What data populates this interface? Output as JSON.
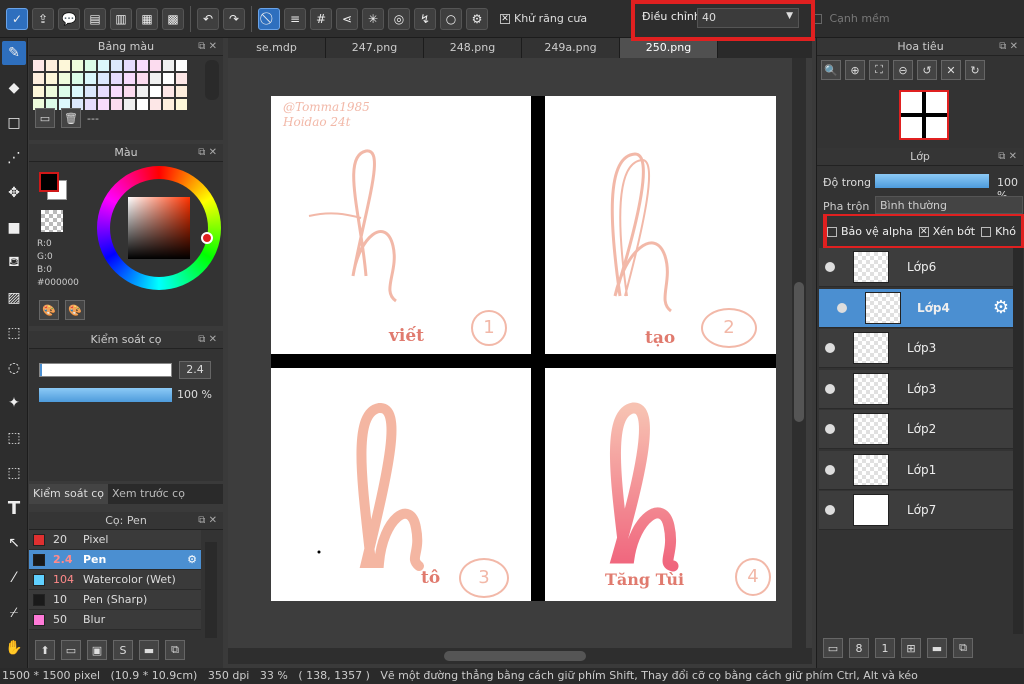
{
  "toolbar": {
    "antialias_label": "Khử răng cưa",
    "adjust_label": "Điều chỉnh",
    "adjust_value": "40",
    "smooth_edge_label": "Cạnh mềm"
  },
  "palette_panel": {
    "title": "Bảng màu",
    "value_text": "---"
  },
  "color_panel": {
    "title": "Màu",
    "r": "R:0",
    "g": "G:0",
    "b": "B:0",
    "hex": "#000000"
  },
  "brush_control": {
    "title": "Kiểm soát cọ",
    "size": "2.4",
    "opacity": "100 %"
  },
  "left_tabs": {
    "tab1": "Kiểm soát cọ",
    "tab2": "Xem trước cọ"
  },
  "brush_panel": {
    "title": "Cọ: Pen",
    "items": [
      {
        "size": "20",
        "name": "Pixel",
        "color": "#e03030"
      },
      {
        "size": "2.4",
        "name": "Pen",
        "color": "#1a1a1a"
      },
      {
        "size": "104",
        "name": "Watercolor (Wet)",
        "color": "#5fd0ff"
      },
      {
        "size": "10",
        "name": "Pen (Sharp)",
        "color": "#1a1a1a"
      },
      {
        "size": "50",
        "name": "Blur",
        "color": "#ff7ad8"
      }
    ]
  },
  "tabs": [
    "se.mdp",
    "247.png",
    "248.png",
    "249a.png",
    "250.png"
  ],
  "canvas": {
    "signature": "@Tomma1985 Hoidao 24t",
    "q1": {
      "word": "viết",
      "num": "1"
    },
    "q2": {
      "word": "tạo",
      "num": "2"
    },
    "q3": {
      "word": "tô",
      "num": "3"
    },
    "q4": {
      "word": "Tăng Tùi",
      "num": "4"
    }
  },
  "navigator": {
    "title": "Hoa tiêu"
  },
  "layer_panel": {
    "title": "Lớp",
    "opacity_label": "Độ trong",
    "opacity_value": "100 %",
    "opacity_level": 1.0,
    "blend_label": "Pha trộn",
    "blend_value": "Bình thường",
    "protect_alpha": "Bảo vệ alpha",
    "clipping": "Xén bớt",
    "lock": "Khó",
    "layers": [
      "Lớp6",
      "Lớp4",
      "Lớp3",
      "Lớp3",
      "Lớp2",
      "Lớp1",
      "Lớp7"
    ]
  },
  "status": {
    "size": "1500 * 1500 pixel",
    "cm": "(10.9 * 10.9cm)",
    "dpi": "350 dpi",
    "zoom": "33 %",
    "coords": "( 138, 1357 )",
    "hint": "Vẽ một đường thẳng bằng cách giữ phím Shift, Thay đổi cỡ cọ bằng cách giữ phím Ctrl, Alt và kéo"
  },
  "colors": {
    "accent": "#4b8fd1",
    "highlight_box": "#e02020",
    "sketch": "#f2b8a8"
  }
}
